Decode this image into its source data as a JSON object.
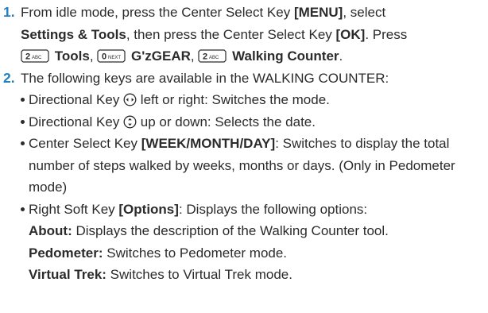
{
  "step1": {
    "number": "1.",
    "intro": "From idle mode, press the Center Select Key ",
    "menu_key": "[MENU]",
    "select_text": ", select",
    "settings_tools": "Settings & Tools",
    "then_press": ", then press the Center Select Key ",
    "ok_key": "[OK]",
    "press_word": ". Press",
    "key1_glyph": "2 ABC",
    "key1_label": "Tools",
    "key2_glyph": "0 NEXT",
    "key2_label": "G'zGEAR",
    "key3_glyph": "2 ABC",
    "key3_label": "Walking Counter",
    "comma": ",",
    "period": "."
  },
  "step2": {
    "number": "2.",
    "intro": "The following keys are available in the WALKING COUNTER:",
    "bullets": {
      "b1_a": "Directional Key ",
      "b1_b": " left or right: Switches the mode.",
      "b2_a": "Directional Key ",
      "b2_b": " up or down: Selects the date.",
      "b3_a": "Center Select Key ",
      "b3_key": "[WEEK/MONTH/DAY]",
      "b3_b": ": Switches to display the total number of steps walked by weeks, months or days. (Only in Pedometer mode)",
      "b4_a": "Right Soft Key ",
      "b4_key": "[Options]",
      "b4_b": ": Displays the following options:"
    },
    "options": {
      "about_label": "About:",
      "about_desc": " Displays the description of the Walking Counter tool.",
      "pedometer_label": "Pedometer:",
      "pedometer_desc": " Switches to Pedometer mode.",
      "trek_label": "Virtual Trek:",
      "trek_desc": " Switches to Virtual Trek mode."
    }
  },
  "icons": {
    "left_right": "directional-left-right-icon",
    "up_down": "directional-up-down-icon",
    "key_2abc": "key-2-abc-icon",
    "key_0next": "key-0-next-icon"
  },
  "colors": {
    "step_number": "#1f7fc0",
    "text": "#2b2b2b"
  }
}
